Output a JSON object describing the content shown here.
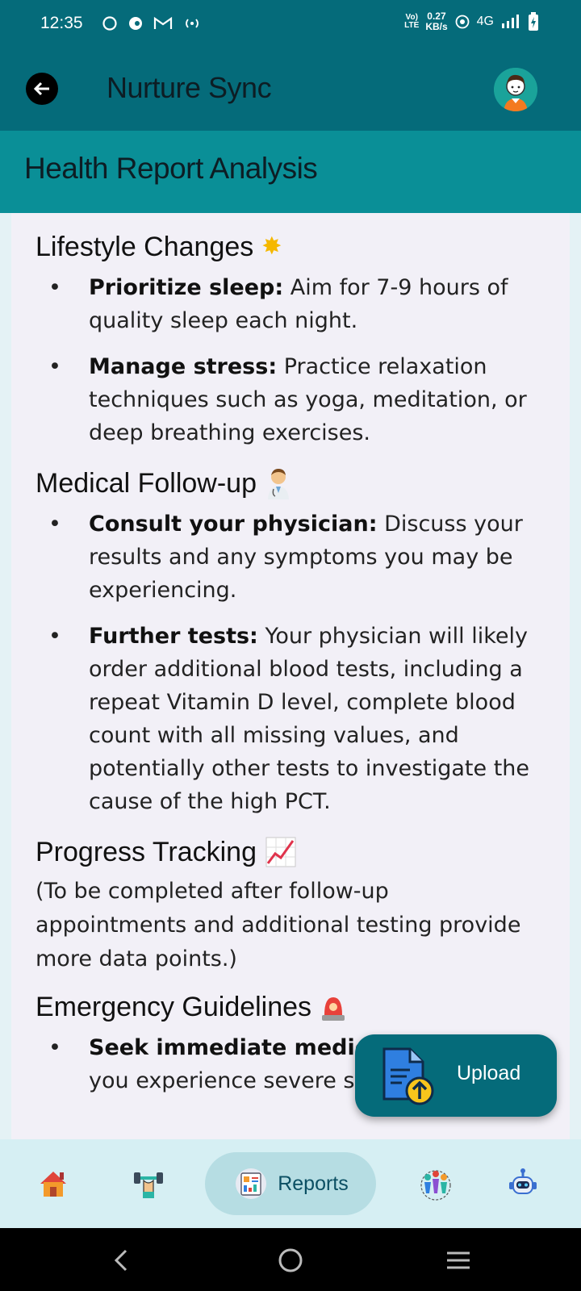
{
  "status_bar": {
    "time": "12:35",
    "network_top": "Vo)",
    "network_bottom": "LTE",
    "speed_value": "0.27",
    "speed_unit": "KB/s",
    "network_type": "4G",
    "icons": [
      "whatsapp-icon",
      "app-icon",
      "gmail-icon",
      "hotspot-icon",
      "wifi-icon",
      "signal-icon",
      "battery-icon"
    ]
  },
  "app_bar": {
    "title": "Nurture Sync",
    "back_icon": "arrow-left-icon",
    "avatar_icon": "user-avatar-icon"
  },
  "page": {
    "title": "Health Report Analysis"
  },
  "sections": {
    "lifestyle": {
      "title": "Lifestyle Changes",
      "emoji": "🌟",
      "items": [
        {
          "label": "Prioritize sleep:",
          "text": " Aim for 7-9 hours of quality sleep each night."
        },
        {
          "label": "Manage stress:",
          "text": "  Practice relaxation techniques such as yoga, meditation, or deep breathing exercises."
        }
      ]
    },
    "medical": {
      "title": "Medical Follow-up",
      "emoji": "👨‍⚕️",
      "items": [
        {
          "label": "Consult your physician:",
          "text": "  Discuss your results and any symptoms you may be experiencing."
        },
        {
          "label": "Further tests:",
          "text": " Your physician will likely order additional blood tests, including a repeat Vitamin D level, complete blood count with all missing values, and potentially other tests to investigate the cause of the high PCT."
        }
      ]
    },
    "progress": {
      "title": "Progress Tracking",
      "emoji": "📈",
      "text": "(To be completed after follow-up appointments and additional testing provide more data points.)"
    },
    "emergency": {
      "title": "Emergency Guidelines",
      "emoji": "🚨",
      "items": [
        {
          "label": "Seek immediate medica",
          "text": "you experience severe sy"
        }
      ]
    }
  },
  "fab": {
    "label": "Upload",
    "icon": "upload-document-icon"
  },
  "bottom_nav": {
    "items": [
      {
        "name": "home",
        "icon": "home-icon"
      },
      {
        "name": "fitness",
        "icon": "dumbbell-icon"
      },
      {
        "name": "reports",
        "icon": "reports-icon",
        "label": "Reports",
        "active": true
      },
      {
        "name": "community",
        "icon": "community-icon"
      },
      {
        "name": "assistant",
        "icon": "robot-icon"
      }
    ]
  },
  "system_nav": {
    "icons": [
      "back-nav-icon",
      "home-nav-icon",
      "recents-nav-icon"
    ]
  },
  "colors": {
    "primary": "#056b7a",
    "header": "#0a8f97",
    "card": "#f2f0f7",
    "nav_bg": "#d6eff3",
    "nav_active": "#b6dde3"
  }
}
